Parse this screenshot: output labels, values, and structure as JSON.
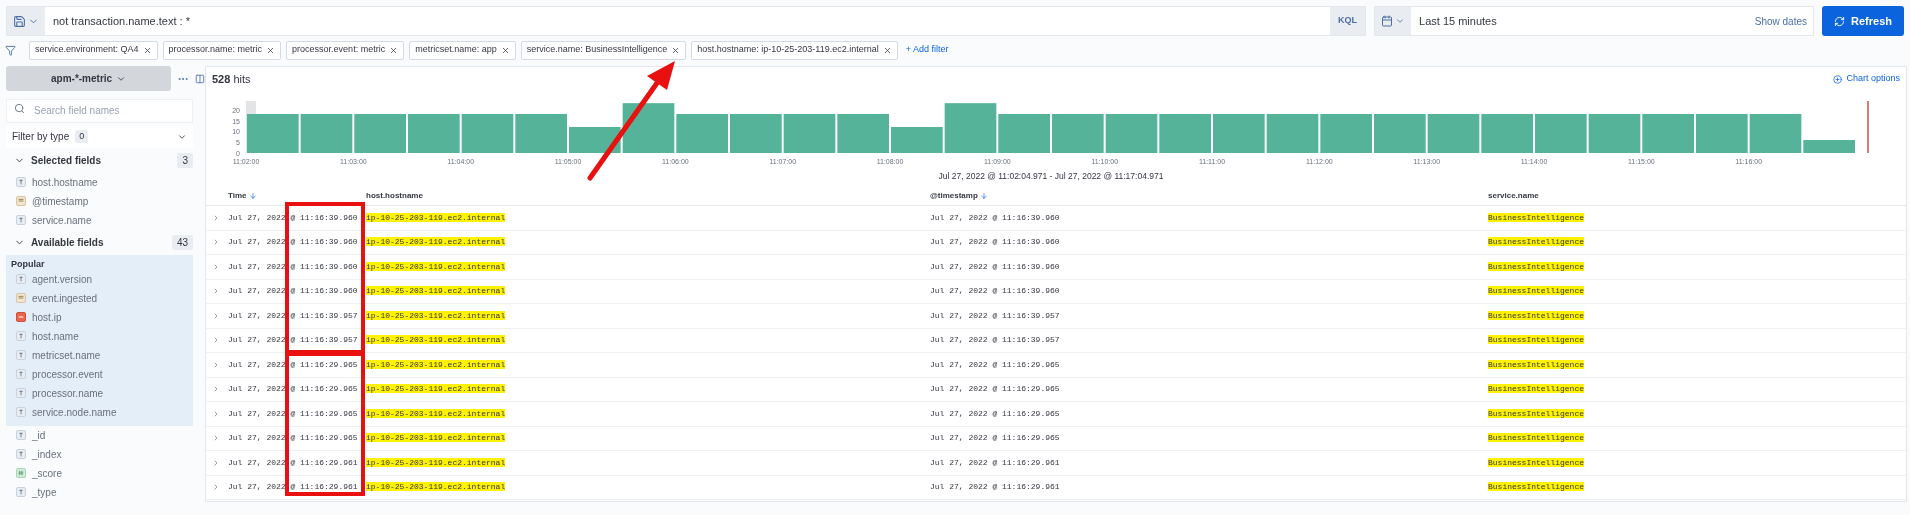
{
  "query_bar": {
    "query": "not transaction.name.text : *",
    "language": "KQL",
    "time_range": "Last 15 minutes",
    "show_dates": "Show dates",
    "refresh": "Refresh"
  },
  "filters": [
    {
      "label": "service.environment: QA4"
    },
    {
      "label": "processor.name: metric"
    },
    {
      "label": "processor.event: metric"
    },
    {
      "label": "metricset.name: app"
    },
    {
      "label": "service.name: BusinessIntelligence"
    },
    {
      "label": "host.hostname: ip-10-25-203-119.ec2.internal"
    }
  ],
  "add_filter": "+ Add filter",
  "sidebar": {
    "index_pattern": "apm-*-metric",
    "search_placeholder": "Search field names",
    "filter_by_type": "Filter by type",
    "filter_count": "0",
    "selected_fields": {
      "title": "Selected fields",
      "count": "3",
      "expanded": true,
      "items": [
        {
          "name": "host.hostname",
          "kind": "string"
        },
        {
          "name": "@timestamp",
          "kind": "date"
        },
        {
          "name": "service.name",
          "kind": "string"
        }
      ]
    },
    "available_fields": {
      "title": "Available fields",
      "count": "43",
      "expanded": true,
      "popular_title": "Popular",
      "popular": [
        {
          "name": "agent.version",
          "kind": "string"
        },
        {
          "name": "event.ingested",
          "kind": "date"
        },
        {
          "name": "host.ip",
          "kind": "ip"
        },
        {
          "name": "host.name",
          "kind": "string"
        },
        {
          "name": "metricset.name",
          "kind": "string"
        },
        {
          "name": "processor.event",
          "kind": "string"
        },
        {
          "name": "processor.name",
          "kind": "string"
        },
        {
          "name": "service.node.name",
          "kind": "string"
        }
      ],
      "items": [
        {
          "name": "_id",
          "kind": "string"
        },
        {
          "name": "_index",
          "kind": "string"
        },
        {
          "name": "_score",
          "kind": "number"
        },
        {
          "name": "_type",
          "kind": "string"
        }
      ]
    }
  },
  "results": {
    "hits_count": "528",
    "hits_label": "hits",
    "chart_options": "Chart options",
    "chart_data": {
      "type": "bar",
      "xlabel": "Jul 27, 2022 @ 11:02:04.971 - Jul 27, 2022 @ 11:17:04.971",
      "ylim": [
        0,
        24
      ],
      "yticks": [
        0,
        5,
        10,
        15,
        20
      ],
      "categories": [
        "11:02:00",
        null,
        "11:03:00",
        null,
        "11:04:00",
        null,
        "11:05:00",
        null,
        "11:06:00",
        null,
        "11:07:00",
        null,
        "11:08:00",
        null,
        "11:09:00",
        null,
        "11:10:00",
        null,
        "11:11:00",
        null,
        "11:12:00",
        null,
        "11:13:00",
        null,
        "11:14:00",
        null,
        "11:15:00",
        null,
        "11:16:00",
        null
      ],
      "values": [
        18,
        18,
        18,
        18,
        18,
        18,
        12,
        23,
        18,
        18,
        18,
        18,
        12,
        23,
        18,
        18,
        18,
        18,
        18,
        18,
        18,
        18,
        18,
        18,
        18,
        18,
        18,
        18,
        18,
        6
      ]
    },
    "columns": [
      {
        "label": "Time",
        "sorted": true
      },
      {
        "label": "host.hostname",
        "sorted": false
      },
      {
        "label": "@timestamp",
        "sorted": true
      },
      {
        "label": "service.name",
        "sorted": false
      }
    ],
    "rows": [
      {
        "time": "Jul 27, 2022 @ 11:16:39.960",
        "host": "ip-10-25-203-119.ec2.internal",
        "timestamp": "Jul 27, 2022 @ 11:16:39.960",
        "service": "BusinessIntelligence"
      },
      {
        "time": "Jul 27, 2022 @ 11:16:39.960",
        "host": "ip-10-25-203-119.ec2.internal",
        "timestamp": "Jul 27, 2022 @ 11:16:39.960",
        "service": "BusinessIntelligence"
      },
      {
        "time": "Jul 27, 2022 @ 11:16:39.960",
        "host": "ip-10-25-203-119.ec2.internal",
        "timestamp": "Jul 27, 2022 @ 11:16:39.960",
        "service": "BusinessIntelligence"
      },
      {
        "time": "Jul 27, 2022 @ 11:16:39.960",
        "host": "ip-10-25-203-119.ec2.internal",
        "timestamp": "Jul 27, 2022 @ 11:16:39.960",
        "service": "BusinessIntelligence"
      },
      {
        "time": "Jul 27, 2022 @ 11:16:39.957",
        "host": "ip-10-25-203-119.ec2.internal",
        "timestamp": "Jul 27, 2022 @ 11:16:39.957",
        "service": "BusinessIntelligence"
      },
      {
        "time": "Jul 27, 2022 @ 11:16:39.957",
        "host": "ip-10-25-203-119.ec2.internal",
        "timestamp": "Jul 27, 2022 @ 11:16:39.957",
        "service": "BusinessIntelligence"
      },
      {
        "time": "Jul 27, 2022 @ 11:16:29.965",
        "host": "ip-10-25-203-119.ec2.internal",
        "timestamp": "Jul 27, 2022 @ 11:16:29.965",
        "service": "BusinessIntelligence"
      },
      {
        "time": "Jul 27, 2022 @ 11:16:29.965",
        "host": "ip-10-25-203-119.ec2.internal",
        "timestamp": "Jul 27, 2022 @ 11:16:29.965",
        "service": "BusinessIntelligence"
      },
      {
        "time": "Jul 27, 2022 @ 11:16:29.965",
        "host": "ip-10-25-203-119.ec2.internal",
        "timestamp": "Jul 27, 2022 @ 11:16:29.965",
        "service": "BusinessIntelligence"
      },
      {
        "time": "Jul 27, 2022 @ 11:16:29.965",
        "host": "ip-10-25-203-119.ec2.internal",
        "timestamp": "Jul 27, 2022 @ 11:16:29.965",
        "service": "BusinessIntelligence"
      },
      {
        "time": "Jul 27, 2022 @ 11:16:29.961",
        "host": "ip-10-25-203-119.ec2.internal",
        "timestamp": "Jul 27, 2022 @ 11:16:29.961",
        "service": "BusinessIntelligence"
      },
      {
        "time": "Jul 27, 2022 @ 11:16:29.961",
        "host": "ip-10-25-203-119.ec2.internal",
        "timestamp": "Jul 27, 2022 @ 11:16:29.961",
        "service": "BusinessIntelligence"
      }
    ]
  }
}
